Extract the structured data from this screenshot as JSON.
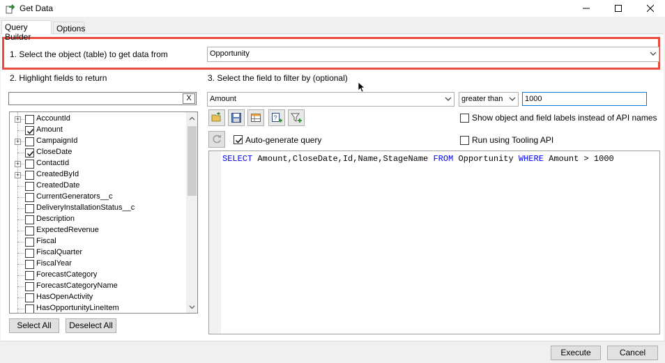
{
  "window": {
    "title": "Get Data"
  },
  "tabs": [
    {
      "label": "Query Builder",
      "active": true
    },
    {
      "label": "Options",
      "active": false
    }
  ],
  "step1": {
    "label": "1. Select the object (table) to get data from",
    "object_value": "Opportunity"
  },
  "step2": {
    "label": "2. Highlight fields to return",
    "search_value": "",
    "clear_label": "X",
    "fields": [
      {
        "name": "AccountId",
        "checked": false,
        "expandable": true
      },
      {
        "name": "Amount",
        "checked": true,
        "expandable": false
      },
      {
        "name": "CampaignId",
        "checked": false,
        "expandable": true
      },
      {
        "name": "CloseDate",
        "checked": true,
        "expandable": false
      },
      {
        "name": "ContactId",
        "checked": false,
        "expandable": true
      },
      {
        "name": "CreatedById",
        "checked": false,
        "expandable": true
      },
      {
        "name": "CreatedDate",
        "checked": false,
        "expandable": false
      },
      {
        "name": "CurrentGenerators__c",
        "checked": false,
        "expandable": false
      },
      {
        "name": "DeliveryInstallationStatus__c",
        "checked": false,
        "expandable": false
      },
      {
        "name": "Description",
        "checked": false,
        "expandable": false
      },
      {
        "name": "ExpectedRevenue",
        "checked": false,
        "expandable": false
      },
      {
        "name": "Fiscal",
        "checked": false,
        "expandable": false
      },
      {
        "name": "FiscalQuarter",
        "checked": false,
        "expandable": false
      },
      {
        "name": "FiscalYear",
        "checked": false,
        "expandable": false
      },
      {
        "name": "ForecastCategory",
        "checked": false,
        "expandable": false
      },
      {
        "name": "ForecastCategoryName",
        "checked": false,
        "expandable": false
      },
      {
        "name": "HasOpenActivity",
        "checked": false,
        "expandable": false
      },
      {
        "name": "HasOpportunityLineItem",
        "checked": false,
        "expandable": false
      }
    ],
    "select_all_label": "Select All",
    "deselect_all_label": "Deselect All"
  },
  "step3": {
    "label": "3. Select the field to filter by (optional)",
    "filter_field": "Amount",
    "operator": "greater than",
    "filter_value": "1000",
    "show_labels_option": "Show object and field labels instead of API names",
    "show_labels_checked": false,
    "tooling_api_option": "Run using Tooling API",
    "tooling_api_checked": false,
    "auto_generate_label": "Auto-generate query",
    "auto_generate_checked": true,
    "toolbar_icons": [
      "open-icon",
      "save-icon",
      "table-icon",
      "add-query-icon",
      "add-filter-icon"
    ],
    "refresh_icon": "refresh-icon"
  },
  "query": {
    "tokens": [
      {
        "text": "SELECT",
        "kw": true
      },
      {
        "text": " Amount,CloseDate,Id,Name,StageName ",
        "kw": false
      },
      {
        "text": "FROM",
        "kw": true
      },
      {
        "text": " Opportunity ",
        "kw": false
      },
      {
        "text": "WHERE",
        "kw": true
      },
      {
        "text": " Amount > 1000",
        "kw": false
      }
    ]
  },
  "footer": {
    "execute_label": "Execute",
    "cancel_label": "Cancel"
  },
  "colors": {
    "highlight_border": "#e74c3c",
    "keyword": "#0000ff",
    "focus": "#0078d7"
  }
}
